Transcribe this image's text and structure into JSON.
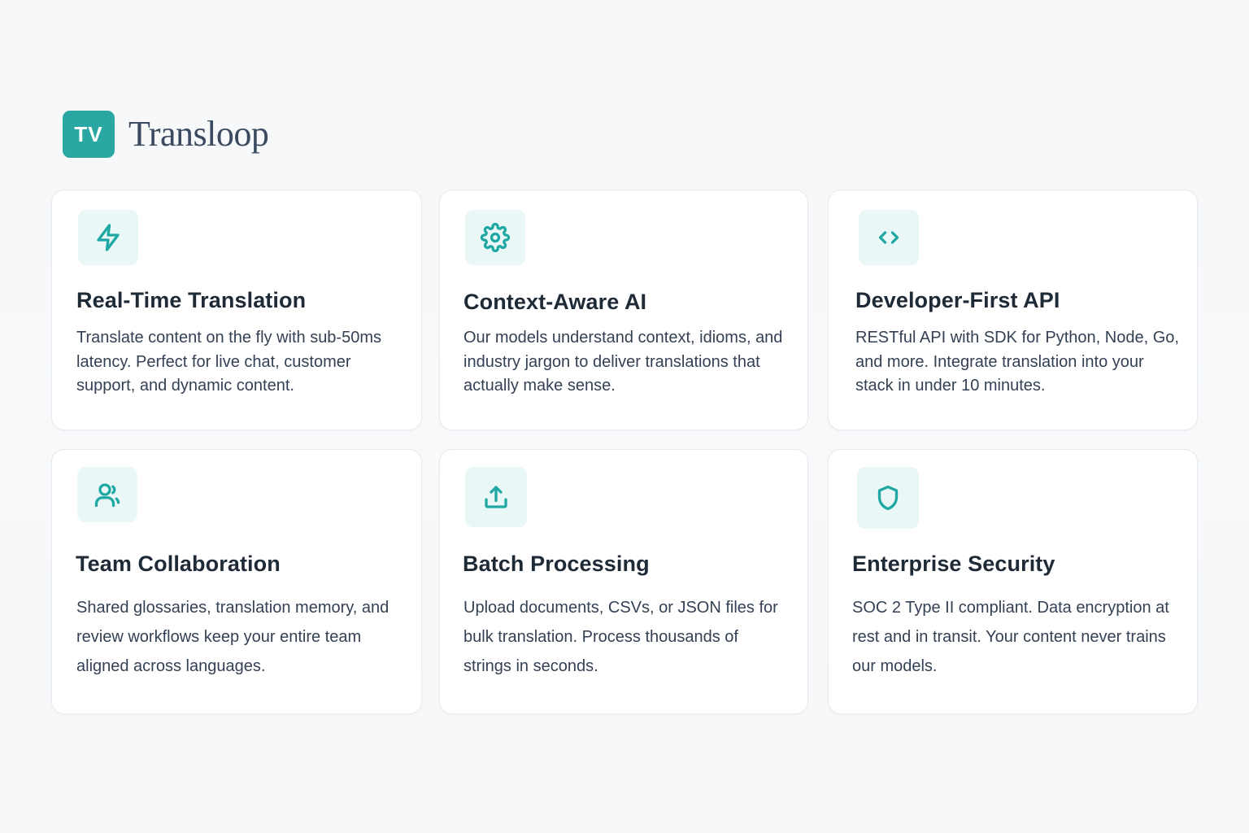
{
  "brand": {
    "logo_initials": "TV",
    "name": "Transloop",
    "accent_color": "#2aa7a3"
  },
  "features": [
    {
      "icon": "lightning-icon",
      "title": "Real-Time Translation",
      "description": "Translate content on the fly with sub-50ms latency. Perfect for live chat, customer support, and dynamic content."
    },
    {
      "icon": "gear-icon",
      "title": "Context-Aware AI",
      "description": "Our models understand context, idioms, and industry jargon to deliver translations that actually make sense."
    },
    {
      "icon": "code-icon",
      "title": "Developer-First API",
      "description": "RESTful API with SDK for Python, Node, Go, and more. Integrate translation into your stack in under 10 minutes."
    },
    {
      "icon": "users-icon",
      "title": "Team Collaboration",
      "description": "Shared glossaries, translation memory, and review workflows keep your entire team aligned across languages."
    },
    {
      "icon": "upload-icon",
      "title": "Batch Processing",
      "description": "Upload documents, CSVs, or JSON files for bulk translation. Process thousands of strings in seconds."
    },
    {
      "icon": "shield-icon",
      "title": "Enterprise Security",
      "description": "SOC 2 Type II compliant. Data encryption at rest and in transit. Your content never trains our models."
    }
  ]
}
